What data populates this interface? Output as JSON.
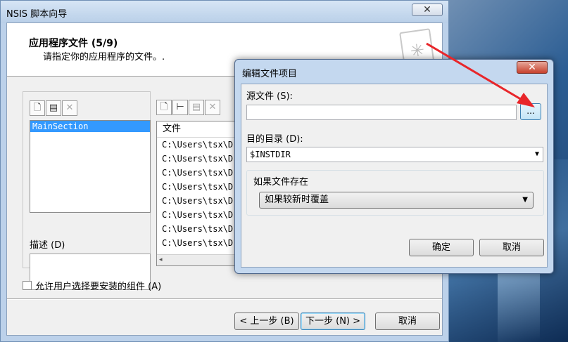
{
  "wizard": {
    "title": "NSIS 脚本向导",
    "close_glyph": "✕",
    "header_title": "应用程序文件  (5/9)",
    "header_subtitle": "请指定你的应用程序的文件。.",
    "sections": [
      "MainSection"
    ],
    "description_label": "描述 (D)",
    "files_column": "文件",
    "files": [
      "C:\\Users\\tsx\\D",
      "C:\\Users\\tsx\\D",
      "C:\\Users\\tsx\\D",
      "C:\\Users\\tsx\\D",
      "C:\\Users\\tsx\\D",
      "C:\\Users\\tsx\\D",
      "C:\\Users\\tsx\\D",
      "C:\\Users\\tsx\\D"
    ],
    "allow_select_label": "允许用户选择要安装的组件 (A)",
    "back_label": "< 上一步 (B)",
    "next_label": "下一步 (N) >",
    "cancel_label": "取消"
  },
  "dialog": {
    "title": "编辑文件项目",
    "close_glyph": "✕",
    "source_label": "源文件 (S):",
    "source_value": "",
    "browse_label": "...",
    "dest_label": "目的目录 (D):",
    "dest_value": "$INSTDIR",
    "exists_group_label": "如果文件存在",
    "exists_option": "如果较新时覆盖",
    "ok_label": "确定",
    "cancel_label": "取消"
  },
  "icons": {
    "new": "new-file-icon",
    "props": "properties-icon",
    "delete": "delete-icon",
    "tree": "tree-icon"
  },
  "colors": {
    "annotation_arrow": "#e8262a",
    "selection": "#3399ff"
  }
}
